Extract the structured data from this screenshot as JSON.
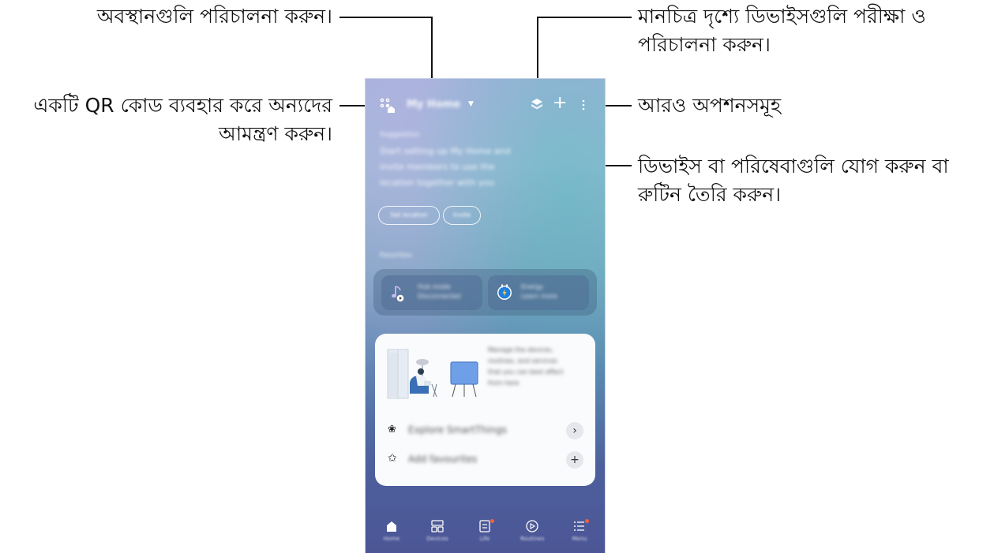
{
  "callouts": {
    "locations": "অবস্থানগুলি পরিচালনা করুন।",
    "qr_line1": "একটি QR কোড ব্যবহার করে অন্যদের",
    "qr_line2": "আমন্ত্রণ করুন।",
    "map_line1": "মানচিত্র দৃশ্যে ডিভাইসগুলি পরীক্ষা ও",
    "map_line2": "পরিচালনা করুন।",
    "more": "আরও অপশনসমূহ",
    "add_line1": "ডিভাইস বা পরিষেবাগুলি যোগ করুন বা",
    "add_line2": "রুটিন তৈরি করুন।"
  },
  "app": {
    "home_name": "My Home",
    "suggestion_label": "Suggestion",
    "suggestion_text": [
      "Start setting up My Home and",
      "invite members to use the",
      "location together with you"
    ],
    "suggestion_buttons": [
      "Set location",
      "Invite"
    ],
    "favorites_label": "Favorites",
    "favorites": [
      {
        "name": "Hub mode",
        "status": "Disconnected",
        "icon": "music-play-icon"
      },
      {
        "name": "Energy",
        "status": "Learn more",
        "icon": "plug-icon"
      }
    ],
    "card_text": [
      "Manage the devices,",
      "routines, and services",
      "that you can best affect",
      "from here"
    ],
    "card_rows": [
      {
        "label": "Explore SmartThings",
        "icon": "fan-icon",
        "action": "chevron-right-icon"
      },
      {
        "label": "Add favourites",
        "icon": "star-icon",
        "action": "plus-icon"
      }
    ],
    "nav": [
      {
        "label": "Home",
        "icon": "home-icon",
        "badge": false
      },
      {
        "label": "Devices",
        "icon": "devices-icon",
        "badge": false
      },
      {
        "label": "Life",
        "icon": "life-icon",
        "badge": true
      },
      {
        "label": "Routines",
        "icon": "play-circle-icon",
        "badge": false
      },
      {
        "label": "Menu",
        "icon": "menu-icon",
        "badge": true
      }
    ]
  },
  "colors": {
    "nav_badge": "#f4623a",
    "card_background": "#fafbfd"
  }
}
